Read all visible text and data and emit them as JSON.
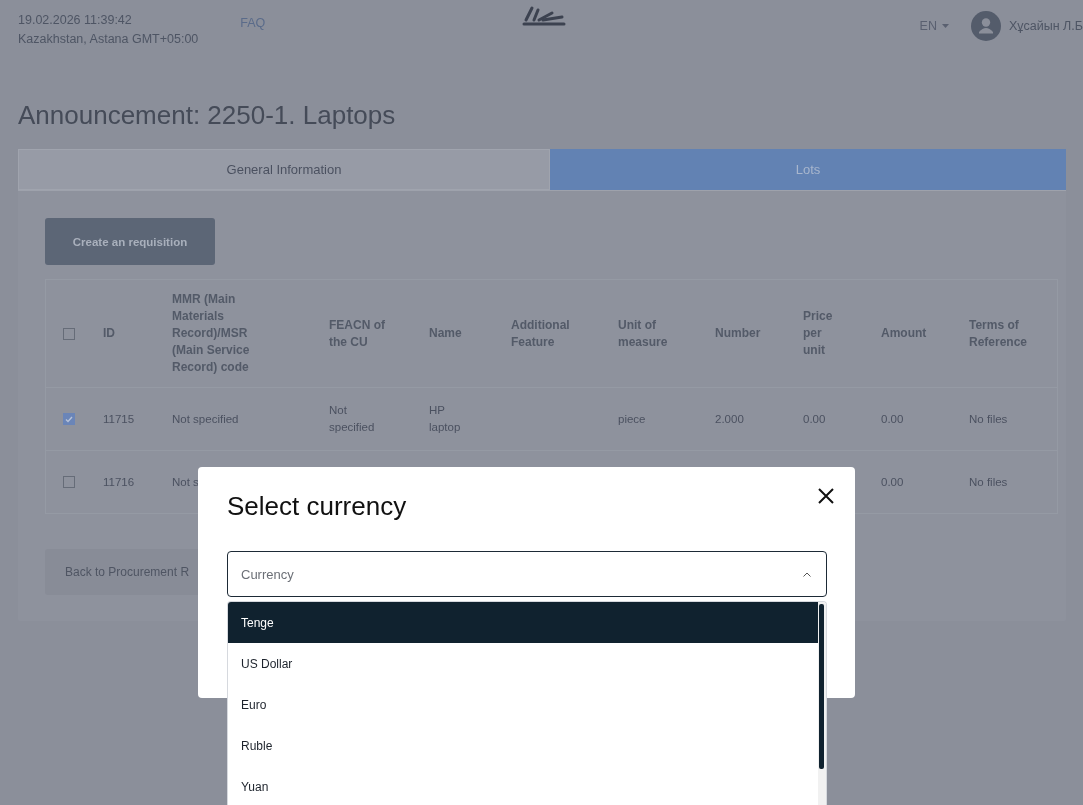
{
  "header": {
    "datetime": "19.02.2026 11:39:42",
    "location": "Kazakhstan, Astana GMT+05:00",
    "nav_link": "FAQ",
    "language": "EN",
    "user_name": "Хұсайын Л.Б"
  },
  "page_title": "Announcement: 2250-1. Laptops",
  "tabs": [
    {
      "label": "General Information",
      "selected": false
    },
    {
      "label": "Lots",
      "selected": true
    }
  ],
  "create_button": "Create an requisition",
  "table": {
    "select_all_checked": false,
    "columns": [
      "ID",
      "MMR (Main Materials Record)/MSR (Main Service Record) code",
      "FEACN of the CU",
      "Name",
      "Additional Feature",
      "Unit of measure",
      "Number",
      "Price per unit",
      "Amount",
      "Terms of Reference"
    ],
    "rows": [
      {
        "checked": true,
        "cells": [
          "11715",
          "Not specified",
          "Not specified",
          "HP laptop",
          "",
          "piece",
          "2.000",
          "0.00",
          "0.00",
          "No files"
        ]
      },
      {
        "checked": false,
        "cells": [
          "11716",
          "Not s",
          "",
          "",
          "",
          "",
          "",
          "",
          "0.00",
          "No files"
        ]
      }
    ]
  },
  "back_button": "Back to Procurement R",
  "modal": {
    "title": "Select currency",
    "field": {
      "placeholder": "Currency",
      "expanded": true
    },
    "options": [
      {
        "label": "Tenge",
        "selected": true
      },
      {
        "label": "US Dollar",
        "selected": false
      },
      {
        "label": "Euro",
        "selected": false
      },
      {
        "label": "Ruble",
        "selected": false
      },
      {
        "label": "Yuan",
        "selected": false
      }
    ]
  }
}
